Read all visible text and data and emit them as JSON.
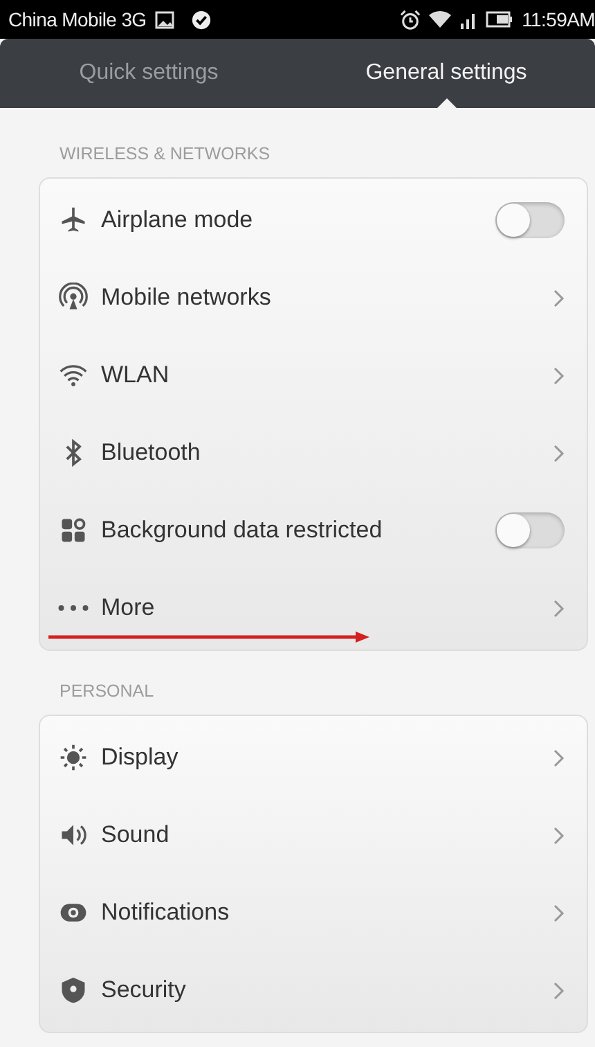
{
  "status_bar": {
    "carrier": "China Mobile 3G",
    "time": "11:59AM"
  },
  "tabs": [
    {
      "label": "Quick settings",
      "selected": false
    },
    {
      "label": "General settings",
      "selected": true
    }
  ],
  "sections": [
    {
      "header": "WIRELESS & NETWORKS",
      "rows": [
        {
          "kind": "toggle",
          "label": "Airplane mode",
          "on": false
        },
        {
          "kind": "link",
          "label": "Mobile networks"
        },
        {
          "kind": "link",
          "label": "WLAN"
        },
        {
          "kind": "link",
          "label": "Bluetooth"
        },
        {
          "kind": "toggle",
          "label": "Background data restricted",
          "on": false
        },
        {
          "kind": "link",
          "label": "More"
        }
      ]
    },
    {
      "header": "PERSONAL",
      "rows": [
        {
          "kind": "link",
          "label": "Display"
        },
        {
          "kind": "link",
          "label": "Sound"
        },
        {
          "kind": "link",
          "label": "Notifications"
        },
        {
          "kind": "link",
          "label": "Security"
        }
      ]
    }
  ]
}
